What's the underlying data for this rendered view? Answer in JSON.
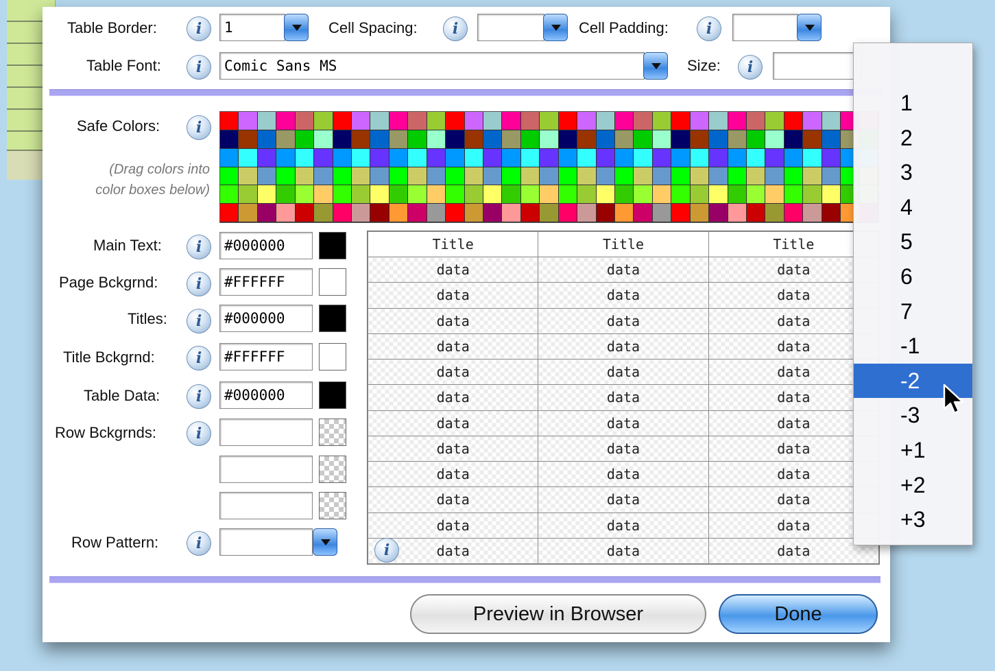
{
  "settings": {
    "table_border": {
      "label": "Table Border:",
      "value": "1"
    },
    "cell_spacing": {
      "label": "Cell Spacing:",
      "value": ""
    },
    "cell_padding": {
      "label": "Cell Padding:",
      "value": ""
    },
    "table_font": {
      "label": "Table Font:",
      "value": "Comic Sans MS"
    },
    "size": {
      "label": "Size:",
      "value": ""
    }
  },
  "safe_colors": {
    "label": "Safe Colors:",
    "hint_line1": "(Drag colors into",
    "hint_line2": "color boxes below)"
  },
  "colors": {
    "main_text": {
      "label": "Main Text:",
      "value": "#000000",
      "swatch": "#000000"
    },
    "page_bg": {
      "label": "Page Bckgrnd:",
      "value": "#FFFFFF",
      "swatch": "#FFFFFF"
    },
    "titles": {
      "label": "Titles:",
      "value": "#000000",
      "swatch": "#000000"
    },
    "title_bg": {
      "label": "Title Bckgrnd:",
      "value": "#FFFFFF",
      "swatch": "#FFFFFF"
    },
    "table_data": {
      "label": "Table Data:",
      "value": "#000000",
      "swatch": "#000000"
    },
    "row_bg": {
      "label": "Row Bckgrnds:",
      "values": [
        "",
        "",
        ""
      ]
    },
    "row_pattern": {
      "label": "Row Pattern:",
      "value": ""
    }
  },
  "preview_table": {
    "headers": [
      "Title",
      "Title",
      "Title"
    ],
    "cell": "data",
    "row_count": 12
  },
  "buttons": {
    "preview": "Preview in Browser",
    "done": "Done"
  },
  "size_menu": {
    "options": [
      "1",
      "2",
      "3",
      "4",
      "5",
      "6",
      "7",
      "-1",
      "-2",
      "-3",
      "+1",
      "+2",
      "+3"
    ],
    "selected": "-2"
  },
  "icons": {
    "info": "info-icon",
    "cursor": "arrow-cursor-icon"
  }
}
